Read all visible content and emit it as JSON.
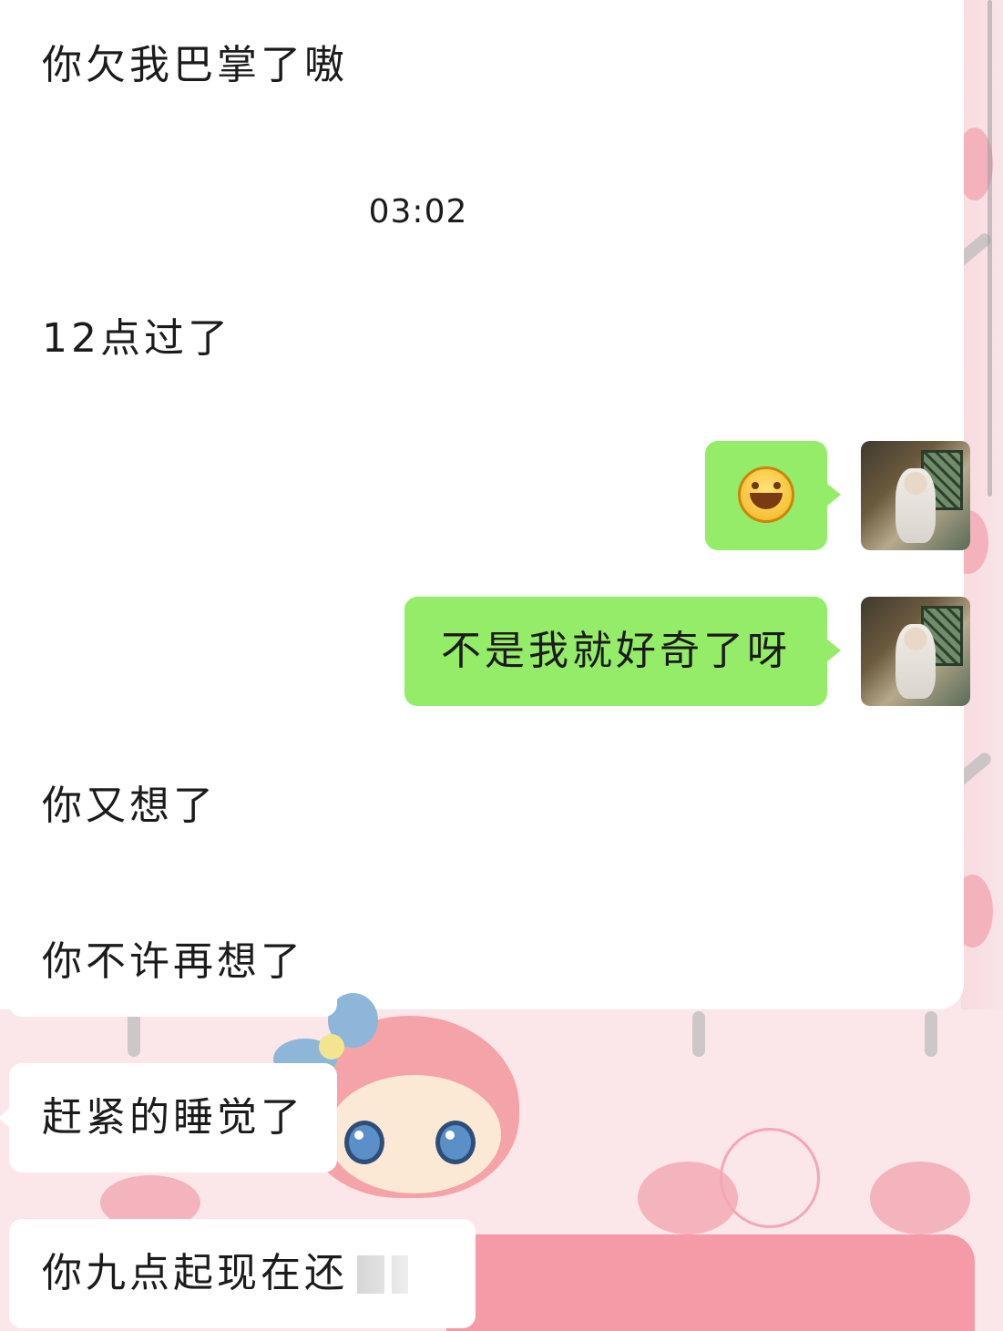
{
  "chat": {
    "timestamp": "03:02",
    "messages": [
      {
        "side": "in",
        "text": "你欠我巴掌了嗷"
      },
      {
        "side": "in",
        "text": "12点过了"
      },
      {
        "side": "out",
        "type": "emoji",
        "emoji": "grinning-face"
      },
      {
        "side": "out",
        "text": "不是我就好奇了呀"
      },
      {
        "side": "in",
        "text": "你又想了"
      },
      {
        "side": "in",
        "text": "你不许再想了"
      },
      {
        "side": "in",
        "text": "赶紧的睡觉了"
      },
      {
        "side": "in",
        "text": "你九点起现在还"
      }
    ]
  },
  "colors": {
    "incoming_bubble": "#ffffff",
    "outgoing_bubble": "#95ec69",
    "wallpaper_pink": "#fbe6ea",
    "text": "#1b1b1b"
  },
  "icons": {
    "avatar": "user-avatar-photo",
    "emoji": "grinning-face-icon"
  }
}
